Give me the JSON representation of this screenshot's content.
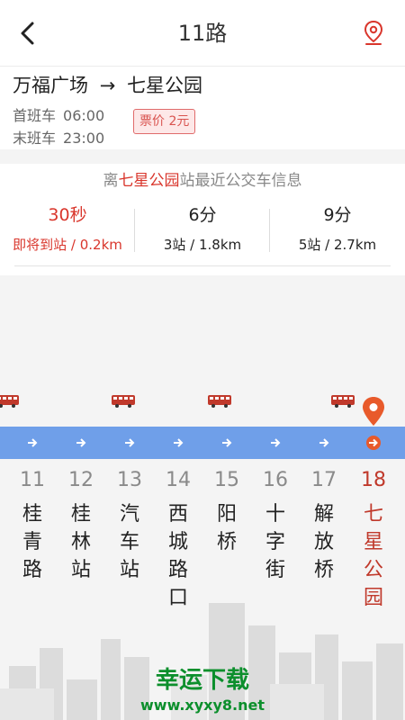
{
  "header": {
    "title": "11路",
    "back_icon": "chevron-left-icon",
    "map_icon": "map-pin-icon"
  },
  "route": {
    "from": "万福广场",
    "arrow": "→",
    "to": "七星公园",
    "first_label": "首班车",
    "first_time": "06:00",
    "last_label": "末班车",
    "last_time": "23:00",
    "fare": "票价 2元"
  },
  "info": {
    "prefix": "离",
    "station": "七星公园",
    "suffix": "站最近公交车信息",
    "etas": [
      {
        "time": "30秒",
        "detail": "即将到站 / 0.2km"
      },
      {
        "time": "6分",
        "detail": "3站 / 1.8km"
      },
      {
        "time": "9分",
        "detail": "5站 / 2.7km"
      }
    ]
  },
  "stops": [
    {
      "num": "11",
      "name": "桂青路"
    },
    {
      "num": "12",
      "name": "桂林站"
    },
    {
      "num": "13",
      "name": "汽车站"
    },
    {
      "num": "14",
      "name": "西城路口"
    },
    {
      "num": "15",
      "name": "阳桥"
    },
    {
      "num": "16",
      "name": "十字街"
    },
    {
      "num": "17",
      "name": "解放桥"
    },
    {
      "num": "18",
      "name": "七星公园"
    }
  ],
  "watermark": {
    "line1": "幸运下载",
    "line2": "www.xyxy8.net"
  },
  "colors": {
    "accent": "#d9362c",
    "road": "#6f9fe9",
    "bus": "#c0392b",
    "pin": "#e85a2b",
    "watermark": "#0c8f2c"
  }
}
